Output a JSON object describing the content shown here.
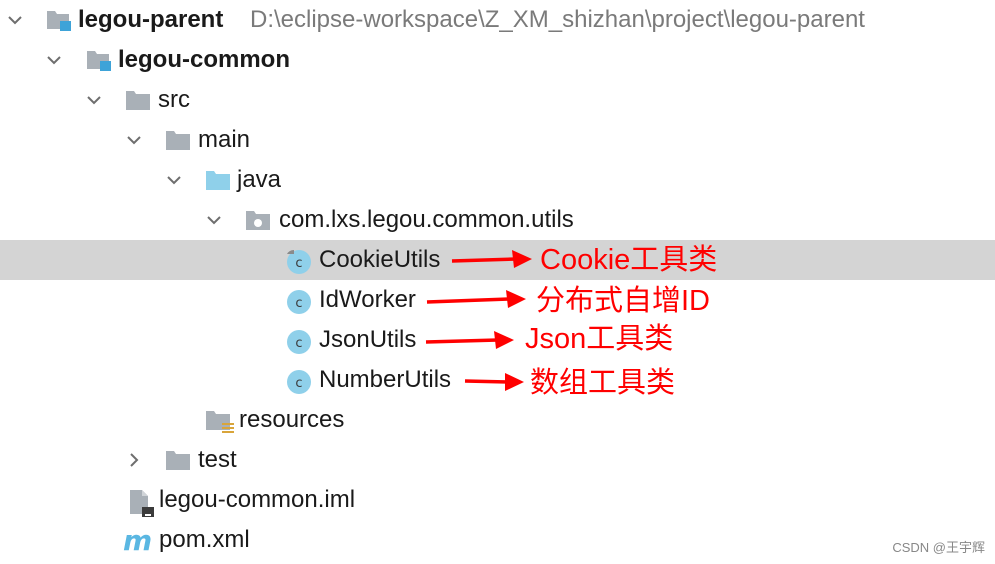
{
  "tree": {
    "parent": {
      "label": "legou-parent",
      "path": "D:\\eclipse-workspace\\Z_XM_shizhan\\project\\legou-parent"
    },
    "common": {
      "label": "legou-common"
    },
    "src": {
      "label": "src"
    },
    "main": {
      "label": "main"
    },
    "java": {
      "label": "java"
    },
    "package": {
      "label": "com.lxs.legou.common.utils"
    },
    "classes": [
      {
        "label": "CookieUtils",
        "icon_letter": "c"
      },
      {
        "label": "IdWorker",
        "icon_letter": "c"
      },
      {
        "label": "JsonUtils",
        "icon_letter": "c"
      },
      {
        "label": "NumberUtils",
        "icon_letter": "c"
      }
    ],
    "resources": {
      "label": "resources"
    },
    "test": {
      "label": "test"
    },
    "iml": {
      "label": "legou-common.iml"
    },
    "pom": {
      "label": "pom.xml",
      "icon_letter": "m"
    }
  },
  "annotations": [
    {
      "text": "Cookie工具类"
    },
    {
      "text": "分布式自增ID"
    },
    {
      "text": "Json工具类"
    },
    {
      "text": "数组工具类"
    }
  ],
  "watermark": "CSDN @王宇辉",
  "colors": {
    "folder": "#a9b0b7",
    "source_folder": "#8fd0ea",
    "module_badge": "#3ea3d8",
    "class_icon": "#8fd0ea",
    "annotation": "#ff0000",
    "selection": "#d4d4d4"
  }
}
